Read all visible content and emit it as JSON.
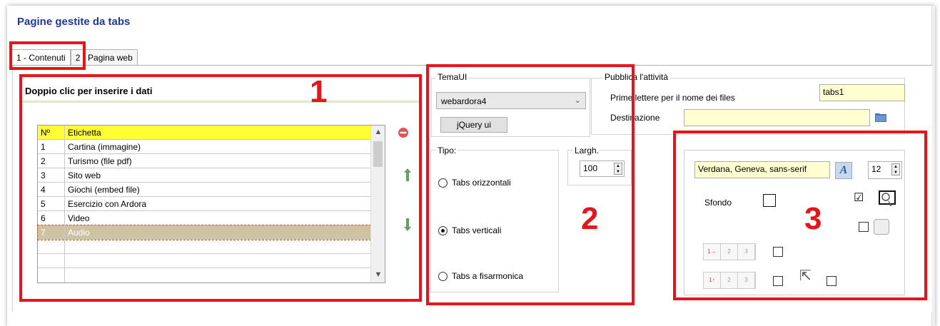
{
  "title": "Pagine gestite da tabs",
  "tabs": [
    {
      "label": "1 - Contenuti",
      "active": true
    },
    {
      "label": "2 - Pagina web",
      "active": false
    }
  ],
  "panel1": {
    "header": "Doppio clic per inserire i dati",
    "columns": [
      "Nº",
      "Etichetta"
    ],
    "rows": [
      {
        "n": "1",
        "label": "Cartina (immagine)"
      },
      {
        "n": "2",
        "label": "Turismo (file pdf)"
      },
      {
        "n": "3",
        "label": "Sito web"
      },
      {
        "n": "4",
        "label": "Giochi (embed file)"
      },
      {
        "n": "5",
        "label": "Esercizio con Ardora"
      },
      {
        "n": "6",
        "label": "Video"
      },
      {
        "n": "7",
        "label": "Audio"
      }
    ],
    "icons": {
      "remove": "remove-icon",
      "up": "arrow-up-icon",
      "down": "arrow-down-icon"
    }
  },
  "panel2": {
    "tema_label": "TemaUI",
    "tema_value": "webardora4",
    "jquery_button": "jQuery ui",
    "tipo_label": "Tipo:",
    "radios": [
      "Tabs orizzontali",
      "Tabs verticali",
      "Tabs a fisarmonica"
    ],
    "selected_radio": "Tabs verticali",
    "largh_label": "Largh.",
    "largh_value": "100"
  },
  "publish": {
    "label": "Pubblica l'attività",
    "prefix_label": "Prime lettere per il nome dei files",
    "prefix_value": "tabs1",
    "dest_label": "Destinazione",
    "dest_value": ""
  },
  "panel3": {
    "font_value": "Verdana, Geneva, sans-serif",
    "size_value": "12",
    "sfondo_label": "Sfondo",
    "checked_mark": "☑"
  },
  "annotations": [
    "1",
    "2",
    "3"
  ],
  "colors": {
    "accent_red": "#e8141b",
    "header_yellow": "#ffff33",
    "selected_row": "#cfc2a2",
    "title_blue": "#1f3a93",
    "input_yellow": "#ffffd0"
  }
}
